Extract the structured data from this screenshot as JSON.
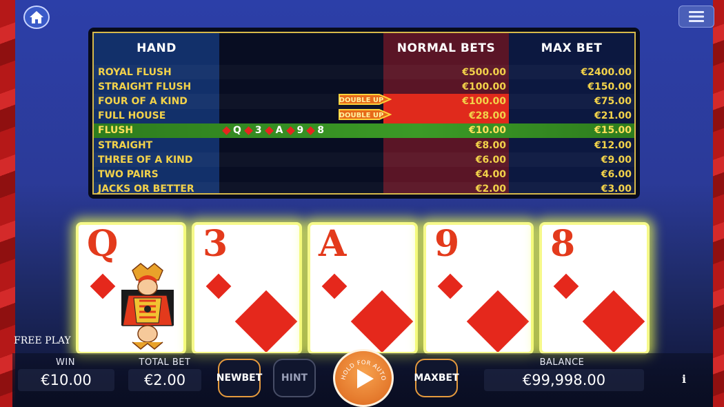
{
  "icons": {
    "home": "home-icon",
    "menu": "hamburger-menu-icon",
    "info": "info-icon",
    "play": "play-icon"
  },
  "colors": {
    "gold": "#f2d24a",
    "active_row": "#3b9a26",
    "highlight": "#e02a1c",
    "card_glow": "#f6f98a",
    "button_border": "#e59a3d"
  },
  "paytable": {
    "headers": {
      "hand": "HAND",
      "normal": "NORMAL BETS",
      "max": "MAX BET"
    },
    "rows": [
      {
        "hand": "ROYAL FLUSH",
        "normal": "€500.00",
        "max": "€2400.00"
      },
      {
        "hand": "STRAIGHT FLUSH",
        "normal": "€100.00",
        "max": "€150.00"
      },
      {
        "hand": "FOUR OF A KIND",
        "normal": "€100.00",
        "max": "€75.00"
      },
      {
        "hand": "FULL HOUSE",
        "normal": "€28.00",
        "max": "€21.00"
      },
      {
        "hand": "FLUSH",
        "normal": "€10.00",
        "max": "€15.00"
      },
      {
        "hand": "STRAIGHT",
        "normal": "€8.00",
        "max": "€12.00"
      },
      {
        "hand": "THREE OF A KIND",
        "normal": "€6.00",
        "max": "€9.00"
      },
      {
        "hand": "TWO PAIRS",
        "normal": "€4.00",
        "max": "€6.00"
      },
      {
        "hand": "JACKS OR BETTER",
        "normal": "€2.00",
        "max": "€3.00"
      }
    ],
    "active_hand": "FLUSH",
    "winning_hand_cards": [
      "Q",
      "3",
      "A",
      "9",
      "8"
    ],
    "double_up_label": "DOUBLE UP"
  },
  "cards": [
    {
      "rank": "Q",
      "suit": "diamonds"
    },
    {
      "rank": "3",
      "suit": "diamonds"
    },
    {
      "rank": "A",
      "suit": "diamonds"
    },
    {
      "rank": "9",
      "suit": "diamonds"
    },
    {
      "rank": "8",
      "suit": "diamonds"
    }
  ],
  "mode_label": "FREE PLAY",
  "bottom": {
    "win_label": "WIN",
    "win_value": "€10.00",
    "total_bet_label": "TOTAL BET",
    "total_bet_value": "€2.00",
    "new_bet": "NEW BET",
    "hint": "HINT",
    "spin_caption": "HOLD FOR AUTOSPIN",
    "max_bet": "MAX BET",
    "balance_label": "BALANCE",
    "balance_value": "€99,998.00",
    "info": "i"
  }
}
